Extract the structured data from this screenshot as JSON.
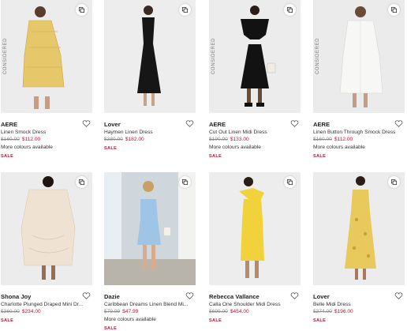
{
  "colors": {
    "sale": "#c8102e",
    "was_price": "#8a8a8a"
  },
  "products": [
    {
      "brand": "AERE",
      "name": "Linen Smock Dress",
      "was_price": "$160.00",
      "price": "$112.00",
      "colours": "More colours available",
      "badge": "SALE",
      "considered": "CONSIDERED",
      "dress_color": "#e6c86a",
      "bg_color": "#ececec"
    },
    {
      "brand": "Lover",
      "name": "Haymen Linen Dress",
      "was_price": "$380.00",
      "price": "$182.00",
      "colours": "",
      "badge": "SALE",
      "considered": "",
      "dress_color": "#161616",
      "bg_color": "#ededed"
    },
    {
      "brand": "AERE",
      "name": "Cut Out Linen Midi Dress",
      "was_price": "$190.00",
      "price": "$133.00",
      "colours": "More colours available",
      "badge": "SALE",
      "considered": "CONSIDERED",
      "dress_color": "#121212",
      "bg_color": "#ececec"
    },
    {
      "brand": "AERE",
      "name": "Linen Button Through Smock Dress",
      "was_price": "$160.00",
      "price": "$112.00",
      "colours": "More colours available",
      "badge": "SALE",
      "considered": "CONSIDERED",
      "dress_color": "#f7f7f5",
      "bg_color": "#ebebeb"
    },
    {
      "brand": "Shona Joy",
      "name": "Charlotte Plunged Draped Mini Dr...",
      "was_price": "$360.00",
      "price": "$234.00",
      "colours": "",
      "badge": "SALE",
      "considered": "",
      "dress_color": "#efe2d2",
      "bg_color": "#ececec"
    },
    {
      "brand": "Dazie",
      "name": "Caribbean Dreams Linen Blend Mi...",
      "was_price": "$79.99",
      "price": "$47.99",
      "colours": "More colours available",
      "badge": "SALE",
      "considered": "",
      "dress_color": "#9ec4e6",
      "bg_color": "#cfd6dc"
    },
    {
      "brand": "Rebecca Vallance",
      "name": "Calla One Shoulder Midi Dress",
      "was_price": "$699.00",
      "price": "$454.00",
      "colours": "",
      "badge": "SALE",
      "considered": "",
      "dress_color": "#f2d23b",
      "bg_color": "#ededed"
    },
    {
      "brand": "Lover",
      "name": "Belle Midi Dress",
      "was_price": "$374.00",
      "price": "$196.00",
      "colours": "",
      "badge": "SALE",
      "considered": "",
      "dress_color": "#e8c95c",
      "bg_color": "#ececec"
    }
  ]
}
